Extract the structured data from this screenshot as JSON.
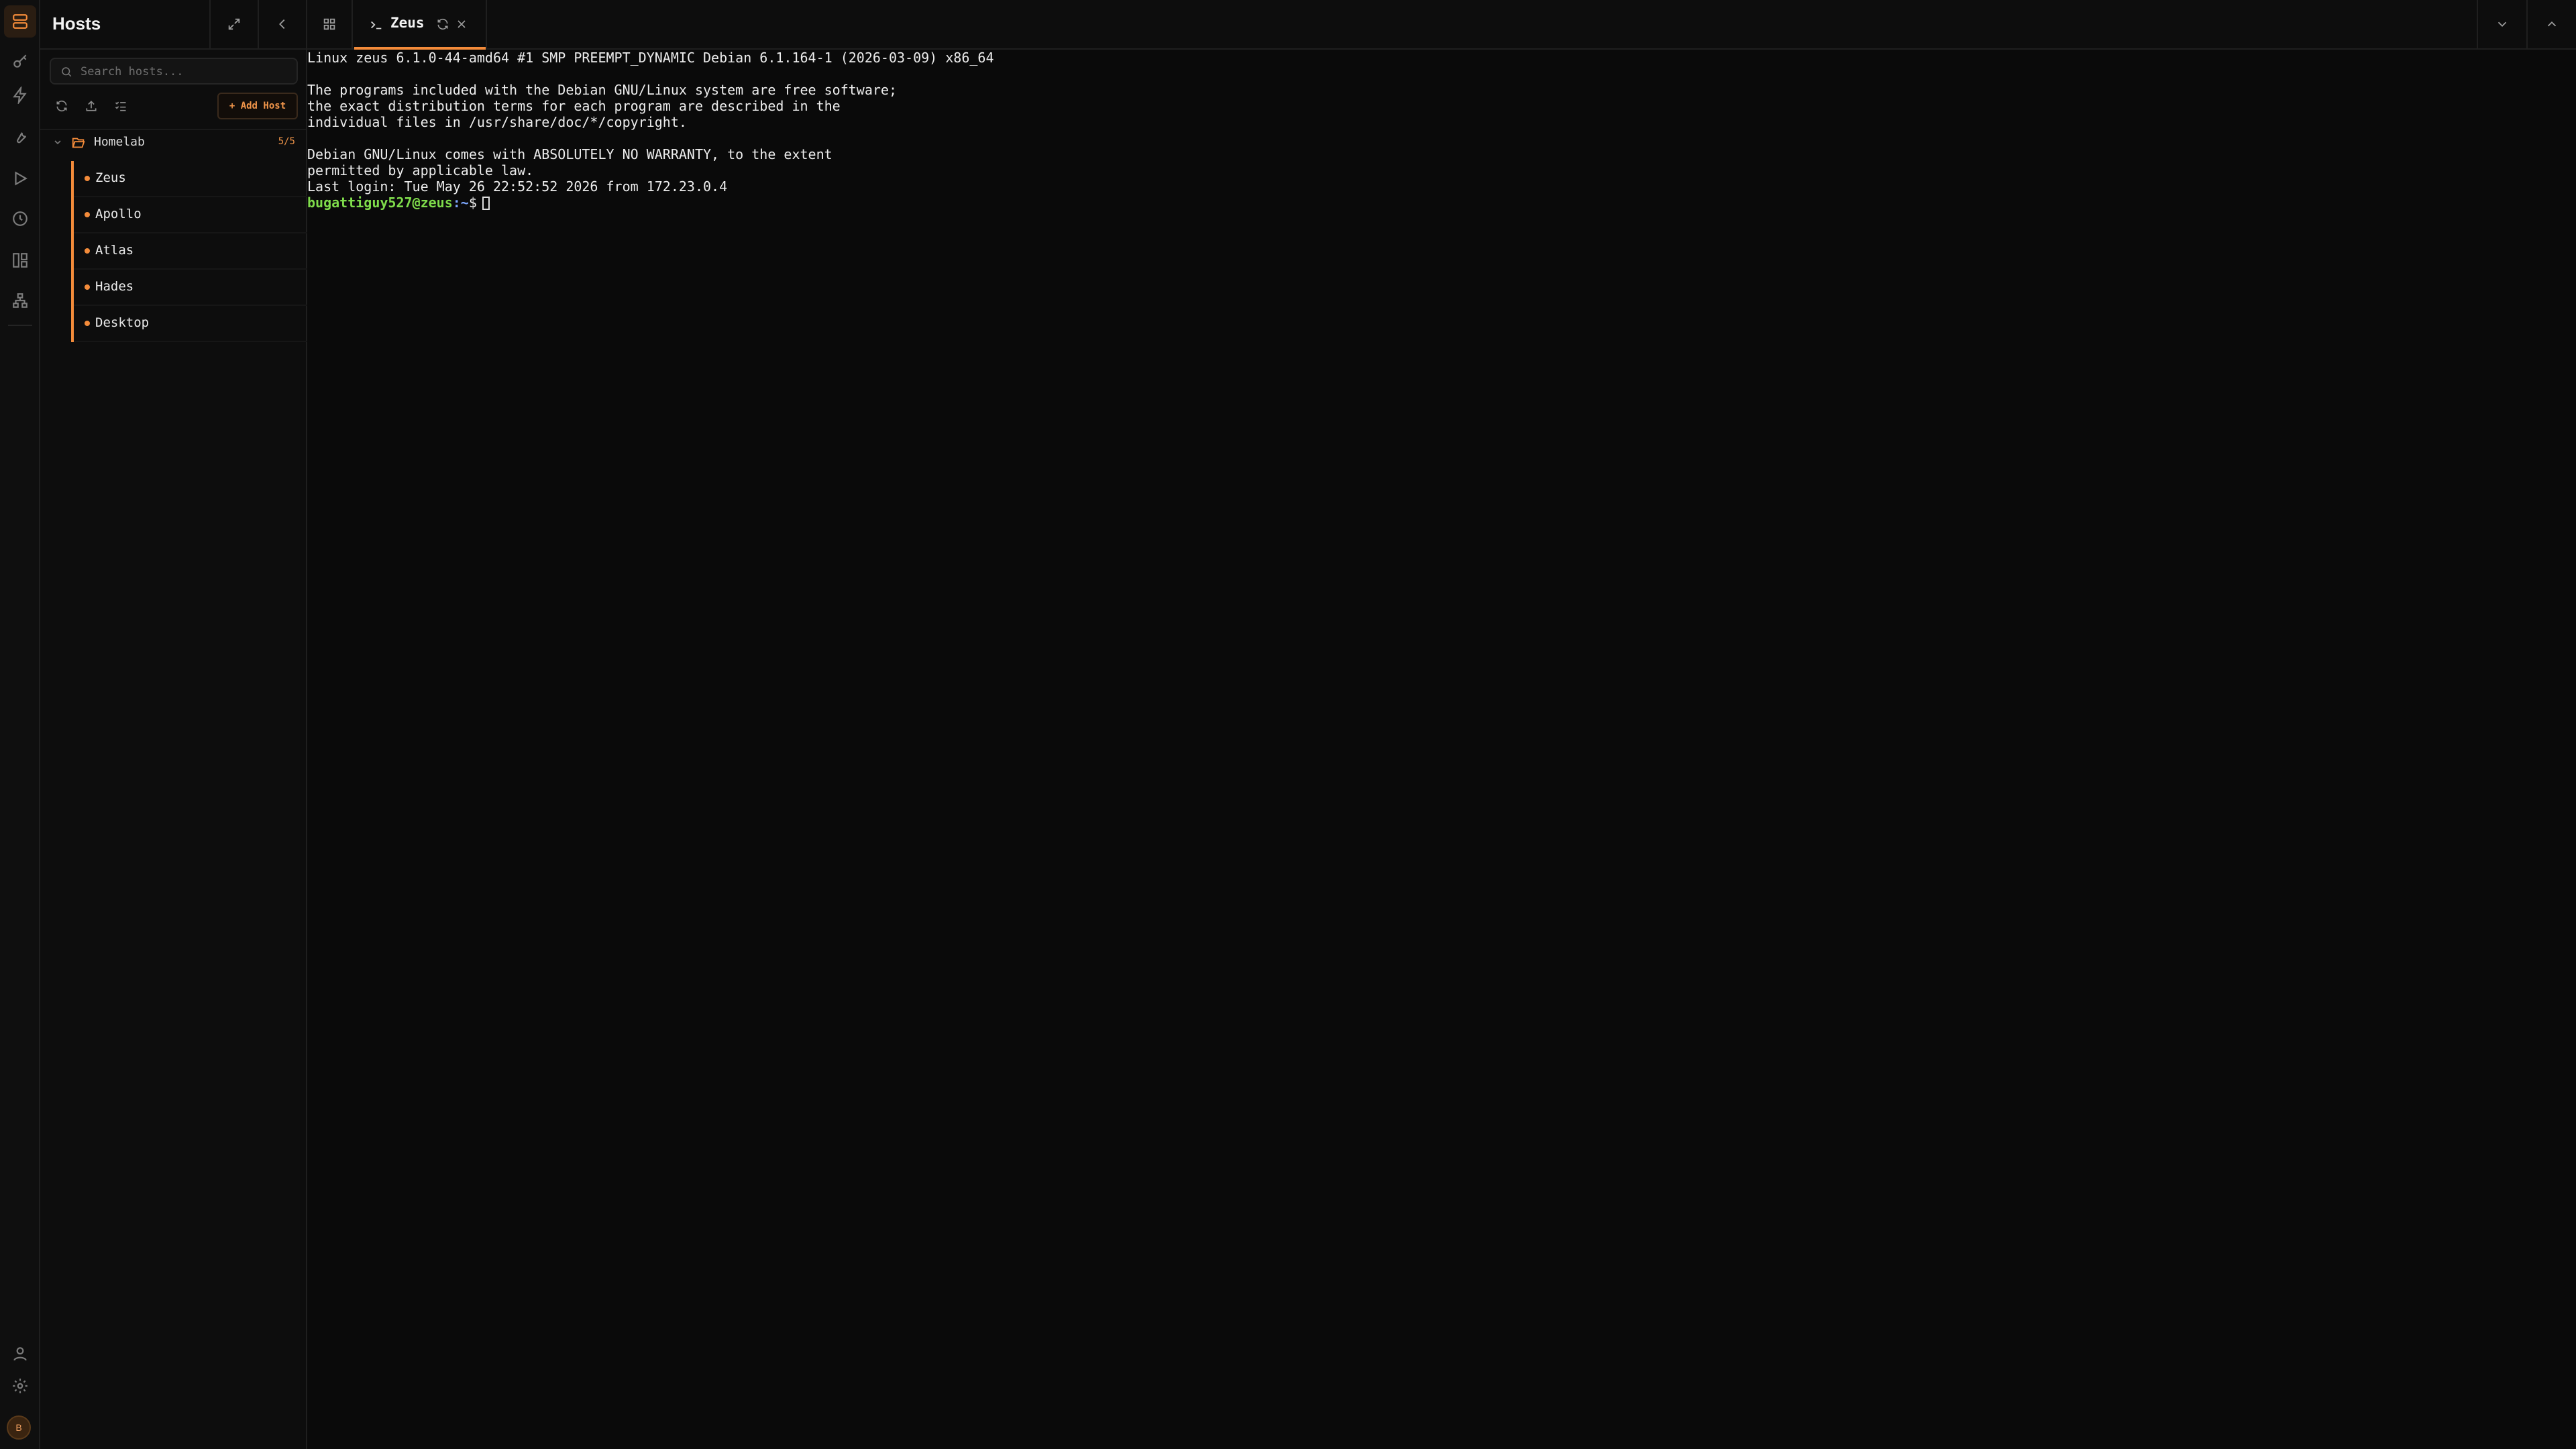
{
  "app": {
    "accent_color": "#f38b3a",
    "avatar_initial": "B"
  },
  "rail": {
    "icons": [
      "hosts-icon",
      "key-icon",
      "lightning-icon",
      "wrench-icon",
      "play-icon",
      "history-icon",
      "dashboard-icon",
      "network-icon"
    ],
    "bottom_icons": [
      "user-icon",
      "gear-icon"
    ]
  },
  "sidebar": {
    "title": "Hosts",
    "search_placeholder": "Search hosts...",
    "add_host_label": "+ Add Host",
    "folder": {
      "name": "Homelab",
      "count": "5/5"
    },
    "hosts": [
      {
        "name": "Zeus"
      },
      {
        "name": "Apollo"
      },
      {
        "name": "Atlas"
      },
      {
        "name": "Hades"
      },
      {
        "name": "Desktop"
      }
    ]
  },
  "tabs": [
    {
      "label": "Zeus",
      "active": true
    }
  ],
  "terminal": {
    "lines": [
      "Linux zeus 6.1.0-44-amd64 #1 SMP PREEMPT_DYNAMIC Debian 6.1.164-1 (2026-03-09) x86_64",
      "",
      "The programs included with the Debian GNU/Linux system are free software;",
      "the exact distribution terms for each program are described in the",
      "individual files in /usr/share/doc/*/copyright.",
      "",
      "Debian GNU/Linux comes with ABSOLUTELY NO WARRANTY, to the extent",
      "permitted by applicable law.",
      "Last login: Tue May 26 22:52:52 2026 from 172.23.0.4"
    ],
    "prompt_user_host": "bugattiguy527@zeus",
    "prompt_path": ":~",
    "prompt_symbol": "$"
  }
}
